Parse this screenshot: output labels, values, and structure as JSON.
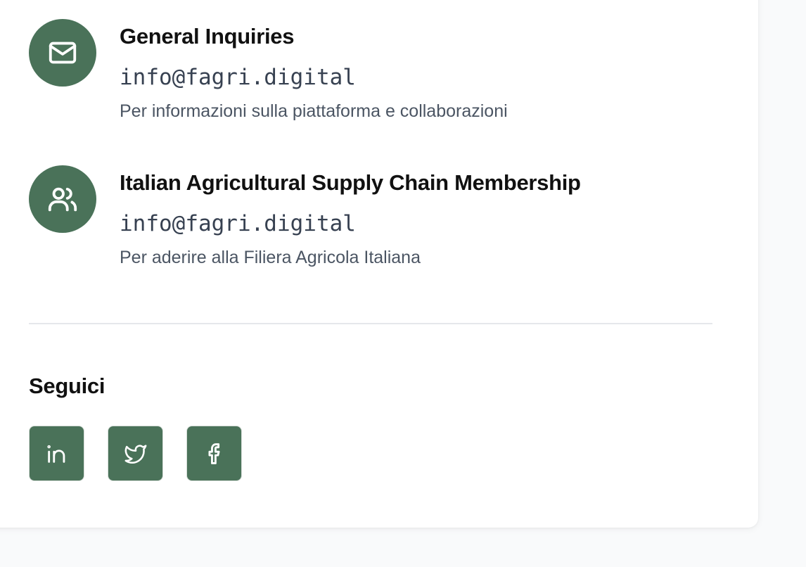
{
  "contacts": [
    {
      "title": "General Inquiries",
      "email": "info@fagri.digital",
      "description": "Per informazioni sulla piattaforma e collaborazioni",
      "icon": "mail-icon"
    },
    {
      "title": "Italian Agricultural Supply Chain Membership",
      "email": "info@fagri.digital",
      "description": "Per aderire alla Filiera Agricola Italiana",
      "icon": "users-icon"
    }
  ],
  "social": {
    "title": "Seguici",
    "links": [
      {
        "icon": "linkedin-icon"
      },
      {
        "icon": "twitter-icon"
      },
      {
        "icon": "facebook-icon"
      }
    ]
  },
  "colors": {
    "accent": "#4a7259",
    "title": "#111111",
    "email": "#374151",
    "description": "#4b5563",
    "divider": "#e5e7eb"
  }
}
